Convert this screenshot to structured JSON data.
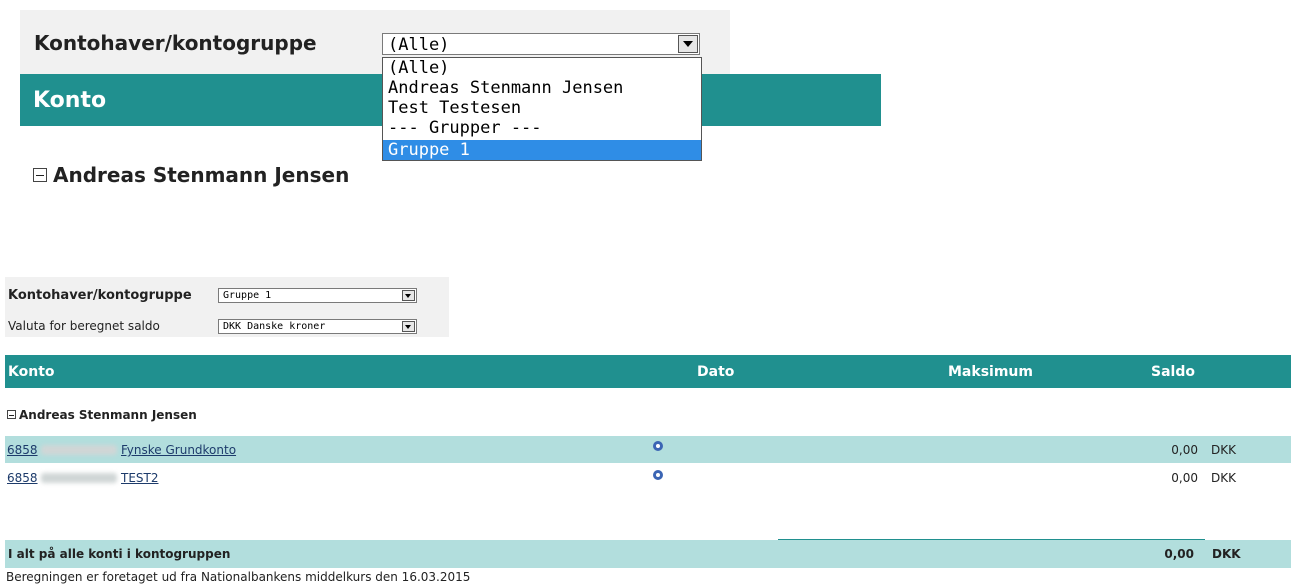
{
  "zoomed_view": {
    "filter_label": "Kontohaver/kontogruppe",
    "select_value": "(Alle)",
    "dropdown_options": [
      {
        "label": "(Alle)",
        "selected": false
      },
      {
        "label": "Andreas Stenmann Jensen",
        "selected": false
      },
      {
        "label": "Test Testesen",
        "selected": false
      },
      {
        "label": "--- Grupper ---",
        "selected": false
      },
      {
        "label": "Gruppe 1",
        "selected": true
      }
    ],
    "header_title": "Konto",
    "owner_name": "Andreas Stenmann Jensen"
  },
  "filters": {
    "owner_label": "Kontohaver/kontogruppe",
    "owner_value": "Gruppe 1",
    "currency_label": "Valuta for beregnet saldo",
    "currency_value": "DKK Danske kroner"
  },
  "table": {
    "columns": {
      "konto": "Konto",
      "dato": "Dato",
      "maksimum": "Maksimum",
      "saldo": "Saldo"
    },
    "owner_name": "Andreas Stenmann Jensen",
    "rows": [
      {
        "reg": "6858",
        "name": "Fynske Grundkonto",
        "saldo": "0,00",
        "currency": "DKK"
      },
      {
        "reg": "6858",
        "name": "TEST2",
        "saldo": "0,00",
        "currency": "DKK"
      }
    ],
    "total_label": "I alt på alle konti i kontogruppen",
    "total_amount": "0,00",
    "total_currency": "DKK"
  },
  "footnote": "Beregningen er foretaget ud fra Nationalbankens middelkurs den 16.03.2015",
  "colors": {
    "header_teal": "#20908f",
    "row_highlight": "#b2dedd",
    "dropdown_selected": "#2f8de6",
    "link": "#1d3b6b"
  },
  "icons": {
    "collapse": "minus-box-icon",
    "status": "status-ring-icon",
    "dropdown": "dropdown-arrow-icon"
  }
}
